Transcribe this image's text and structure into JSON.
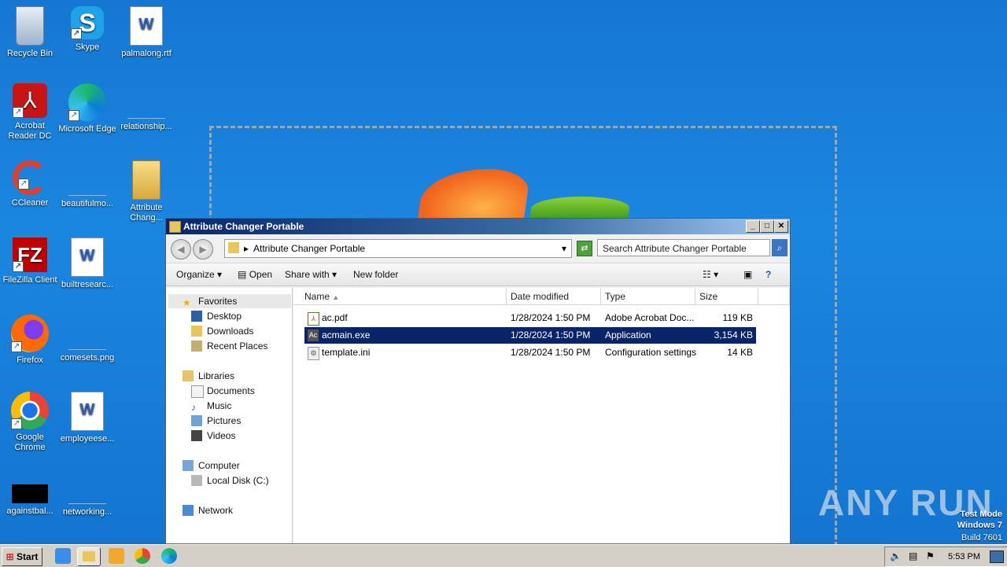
{
  "desktop": {
    "icons": [
      {
        "label": "Recycle Bin",
        "icon": "recycle-bin-icon"
      },
      {
        "label": "Skype",
        "icon": "skype-icon"
      },
      {
        "label": "palmalong.rtf",
        "icon": "word-document-icon"
      },
      {
        "label": "Acrobat Reader DC",
        "icon": "acrobat-icon"
      },
      {
        "label": "Microsoft Edge",
        "icon": "edge-icon"
      },
      {
        "label": "relationship...",
        "icon": "blank-file-icon"
      },
      {
        "label": "CCleaner",
        "icon": "ccleaner-icon"
      },
      {
        "label": "beautifulmo...",
        "icon": "blank-file-icon"
      },
      {
        "label": "Attribute Chang...",
        "icon": "folder-icon"
      },
      {
        "label": "FileZilla Client",
        "icon": "filezilla-icon"
      },
      {
        "label": "builtresearc...",
        "icon": "word-document-icon"
      },
      {
        "label": "Firefox",
        "icon": "firefox-icon"
      },
      {
        "label": "comesets.png",
        "icon": "blank-file-icon"
      },
      {
        "label": "Google Chrome",
        "icon": "chrome-icon"
      },
      {
        "label": "employeese...",
        "icon": "word-document-icon"
      },
      {
        "label": "againstbal...",
        "icon": "black-file-icon"
      },
      {
        "label": "networking...",
        "icon": "blank-file-icon"
      }
    ]
  },
  "window": {
    "title": "Attribute Changer Portable",
    "address": "Attribute Changer Portable",
    "search_placeholder": "Search Attribute Changer Portable",
    "toolbar": {
      "organize": "Organize",
      "open": "Open",
      "share_with": "Share with",
      "new_folder": "New folder"
    },
    "nav": {
      "favorites": "Favorites",
      "desktop": "Desktop",
      "downloads": "Downloads",
      "recent": "Recent Places",
      "libraries": "Libraries",
      "documents": "Documents",
      "music": "Music",
      "pictures": "Pictures",
      "videos": "Videos",
      "computer": "Computer",
      "local_disk": "Local Disk (C:)",
      "network": "Network"
    },
    "columns": {
      "name": "Name",
      "date": "Date modified",
      "type": "Type",
      "size": "Size"
    },
    "files": [
      {
        "name": "ac.pdf",
        "date": "1/28/2024 1:50 PM",
        "type": "Adobe Acrobat Doc...",
        "size": "119 KB",
        "icon": "pdf-icon"
      },
      {
        "name": "acmain.exe",
        "date": "1/28/2024 1:50 PM",
        "type": "Application",
        "size": "3,154 KB",
        "icon": "exe-icon",
        "selected": true
      },
      {
        "name": "template.ini",
        "date": "1/28/2024 1:50 PM",
        "type": "Configuration settings",
        "size": "14 KB",
        "icon": "ini-icon"
      }
    ]
  },
  "taskbar": {
    "start": "Start",
    "clock": "5:53 PM"
  },
  "watermark": {
    "line1": "Test Mode",
    "line2": "Windows 7",
    "line3": "Build 7601",
    "anyrun": "ANY RUN"
  }
}
